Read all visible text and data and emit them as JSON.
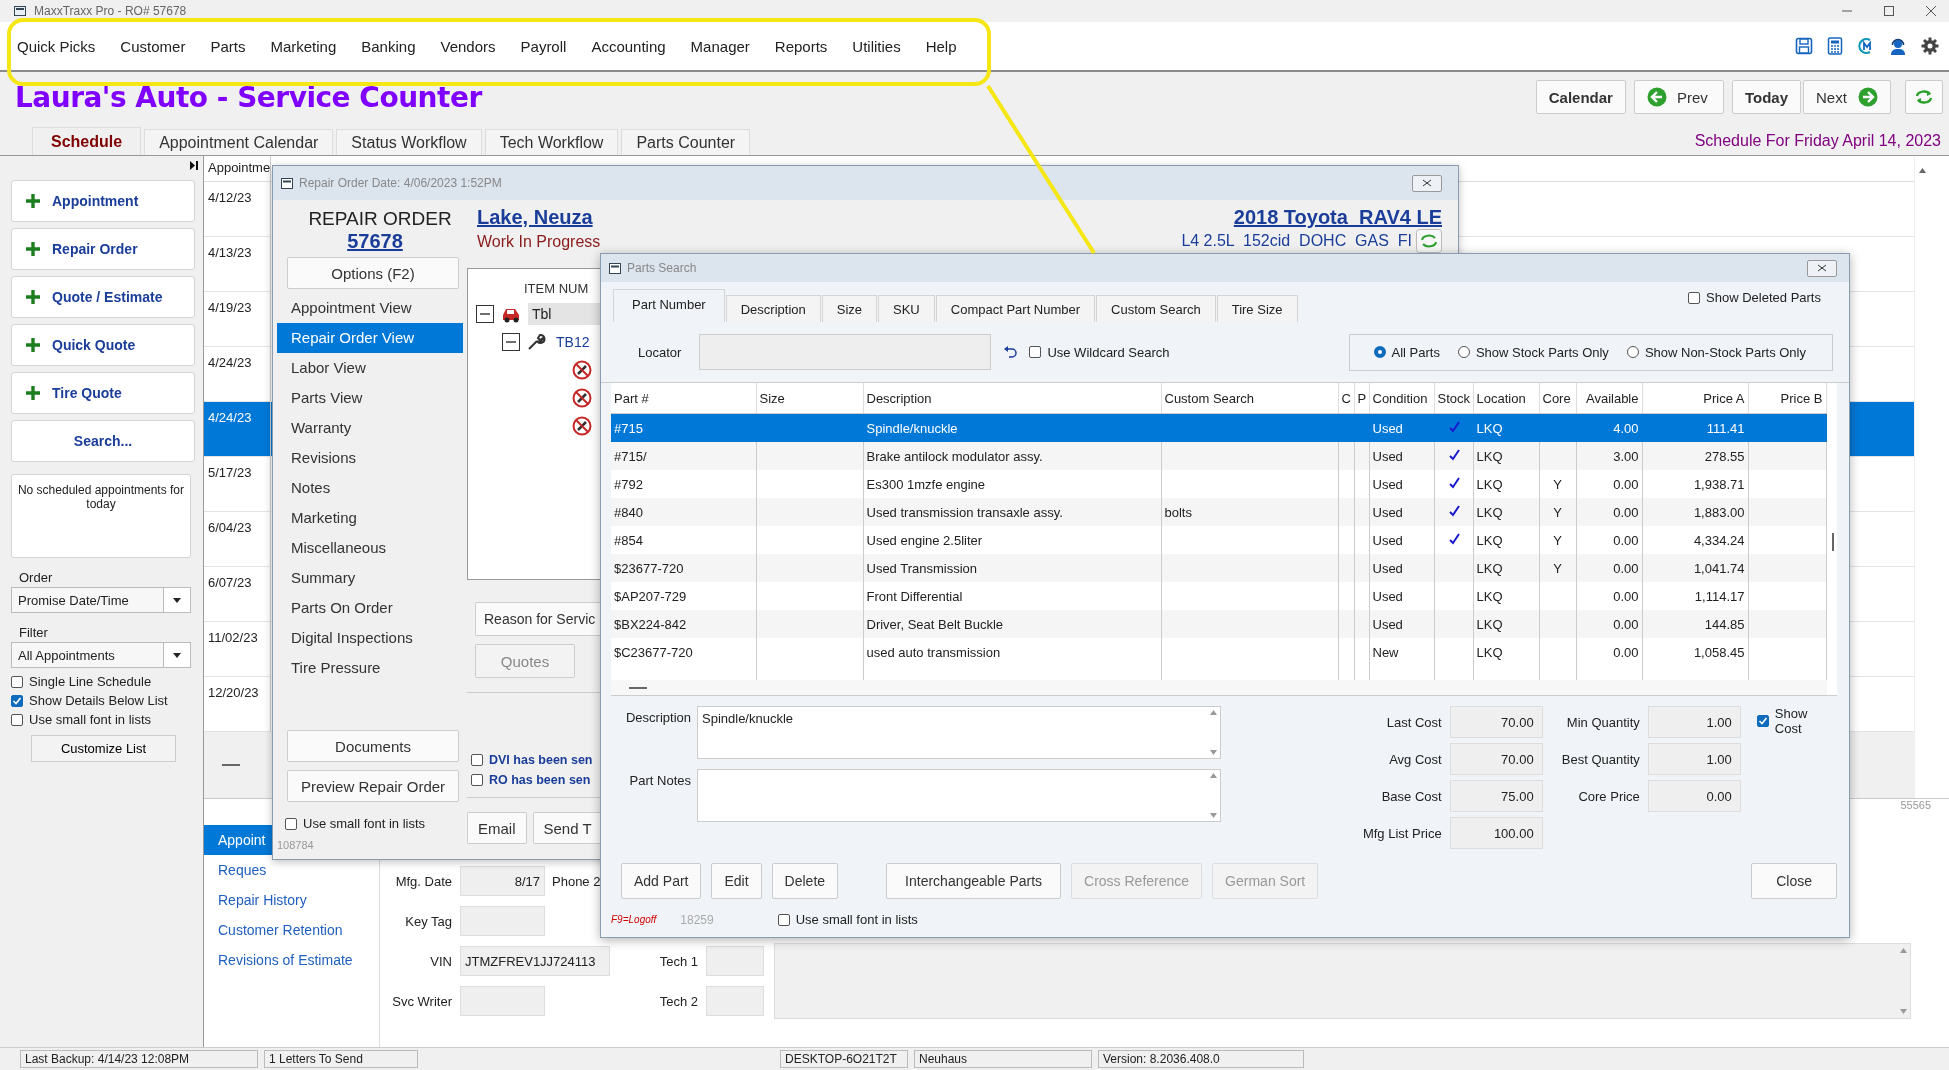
{
  "window": {
    "title": "MaxxTraxx Pro - RO# 57678"
  },
  "menu": [
    "Quick Picks",
    "Customer",
    "Parts",
    "Marketing",
    "Banking",
    "Vendors",
    "Payroll",
    "Accounting",
    "Manager",
    "Reports",
    "Utilities",
    "Help"
  ],
  "shop_title": "Laura's Auto - Service Counter",
  "nav_buttons": [
    {
      "label": "Calendar",
      "kind": "bold"
    },
    {
      "label": "Prev",
      "kind": "prev"
    },
    {
      "label": "Today",
      "kind": "bold"
    },
    {
      "label": "Next",
      "kind": "next"
    }
  ],
  "schedule_heading": "Schedule For Friday April 14, 2023",
  "tabs": [
    {
      "label": "Schedule",
      "selected": true
    },
    {
      "label": "Appointment Calendar",
      "selected": false
    },
    {
      "label": "Status Workflow",
      "selected": false
    },
    {
      "label": "Tech Workflow",
      "selected": false
    },
    {
      "label": "Parts Counter",
      "selected": false
    }
  ],
  "sidebar": {
    "actions": [
      {
        "label": "Appointment",
        "kind": "add"
      },
      {
        "label": "Repair Order",
        "kind": "add"
      },
      {
        "label": "Quote / Estimate",
        "kind": "add"
      },
      {
        "label": "Quick Quote",
        "kind": "add"
      },
      {
        "label": "Tire Quote",
        "kind": "add"
      },
      {
        "label": "Search...",
        "kind": "plain"
      }
    ],
    "empty_note": "No scheduled appointments for today",
    "order": {
      "label": "Order",
      "value": "Promise Date/Time"
    },
    "filter": {
      "label": "Filter",
      "value": "All Appointments"
    },
    "options": [
      {
        "label": "Single Line Schedule",
        "checked": false
      },
      {
        "label": "Show Details Below List",
        "checked": true
      },
      {
        "label": "Use small font in lists",
        "checked": false
      }
    ],
    "customize_button": "Customize List"
  },
  "appointments": {
    "header": "Appointme",
    "rows": [
      {
        "date": "4/12/23",
        "selected": false
      },
      {
        "date": "4/13/23",
        "selected": false
      },
      {
        "date": "4/19/23",
        "selected": false
      },
      {
        "date": "4/24/23",
        "selected": false
      },
      {
        "date": "4/24/23",
        "selected": true
      },
      {
        "date": "5/17/23",
        "selected": false
      },
      {
        "date": "6/04/23",
        "selected": false
      },
      {
        "date": "6/07/23",
        "selected": false
      },
      {
        "date": "11/02/23",
        "selected": false
      },
      {
        "date": "12/20/23",
        "selected": false
      }
    ]
  },
  "record_count": "55565",
  "bottom_links": [
    {
      "label": "Appoint",
      "selected": true
    },
    {
      "label": "Reques",
      "selected": false
    },
    {
      "label": "Repair History",
      "selected": false
    },
    {
      "label": "Customer Retention",
      "selected": false
    },
    {
      "label": "Revisions of Estimate",
      "selected": false
    }
  ],
  "vehicle_fields": [
    {
      "label": "Mfg. Date",
      "value": "8/17"
    },
    {
      "label": "Key Tag"
    },
    {
      "label": "VIN",
      "value": "JTMZFREV1JJ724113"
    },
    {
      "label": "Svc Writer"
    }
  ],
  "staff_fields": [
    {
      "label": "Phone 2",
      "kind": "label"
    },
    {
      "label": "Tech 1",
      "kind": "field"
    },
    {
      "label": "Tech 2",
      "kind": "field"
    }
  ],
  "status_bar": [
    "Last Backup:  4/14/23  12:08PM",
    "1 Letters To Send",
    "DESKTOP-6O21T2T",
    "Neuhaus",
    "Version:  8.2036.408.0"
  ],
  "repair_order": {
    "title": "Repair Order Date:  4/06/2023   1:52PM",
    "heading": "REPAIR ORDER",
    "number": "57678",
    "customer": "Lake, Neuza",
    "status": "Work In Progress",
    "vehicle": "2018 Toyota  RAV4 LE",
    "engine": "L4 2.5L  152cid  DOHC  GAS  FI",
    "options_button": "Options (F2)",
    "views": [
      {
        "label": "Appointment View",
        "selected": false
      },
      {
        "label": "Repair Order View",
        "selected": true
      },
      {
        "label": "Labor View",
        "selected": false
      },
      {
        "label": "Parts View",
        "selected": false
      },
      {
        "label": "Warranty",
        "selected": false
      },
      {
        "label": "Revisions",
        "selected": false
      },
      {
        "label": "Notes",
        "selected": false
      },
      {
        "label": "Marketing",
        "selected": false
      },
      {
        "label": "Miscellaneous",
        "selected": false
      },
      {
        "label": "Summary",
        "selected": false
      },
      {
        "label": "Parts On Order",
        "selected": false
      },
      {
        "label": "Digital Inspections",
        "selected": false
      },
      {
        "label": "Tire Pressure",
        "selected": false
      }
    ],
    "documents_button": "Documents",
    "preview_button": "Preview Repair Order",
    "small_font": {
      "label": "Use small font in lists",
      "checked": false
    },
    "code": "108784",
    "tree": {
      "header": "ITEM NUM",
      "items": [
        {
          "label": "Tbl",
          "kind": "vehicle",
          "expanded": true,
          "children": [
            {
              "label": "TB12",
              "kind": "job",
              "expanded": true,
              "children": [
                {
                  "kind": "part"
                },
                {
                  "kind": "part"
                },
                {
                  "kind": "part"
                }
              ]
            }
          ]
        }
      ]
    },
    "reason_button": "Reason for Servic",
    "quotes_button": "Quotes",
    "notices": [
      {
        "label": "DVI has been sen",
        "checked": false
      },
      {
        "label": "RO has been sen",
        "checked": false
      }
    ],
    "actions": [
      "Email",
      "Send T"
    ]
  },
  "parts_search": {
    "title": "Parts Search",
    "tabs": [
      {
        "label": "Part Number",
        "selected": true
      },
      {
        "label": "Description",
        "selected": false
      },
      {
        "label": "Size",
        "selected": false
      },
      {
        "label": "SKU",
        "selected": false
      },
      {
        "label": "Compact Part Number",
        "selected": false
      },
      {
        "label": "Custom Search",
        "selected": false
      },
      {
        "label": "Tire Size",
        "selected": false
      }
    ],
    "show_deleted": {
      "label": "Show Deleted Parts",
      "checked": false
    },
    "locator_label": "Locator",
    "wildcard": {
      "label": "Use Wildcard Search",
      "checked": false
    },
    "filters": [
      {
        "label": "All Parts",
        "selected": true
      },
      {
        "label": "Show Stock Parts Only",
        "selected": false
      },
      {
        "label": "Show Non-Stock Parts Only",
        "selected": false
      }
    ],
    "table": {
      "columns": [
        "Part #",
        "Size",
        "Description",
        "Custom Search",
        "C",
        "P",
        "Condition",
        "Stock",
        "Location",
        "Core",
        "Available",
        "Price A",
        "Price B"
      ],
      "rows": [
        {
          "part": "#715",
          "description": "Spindle/knuckle",
          "condition": "Used",
          "stock": true,
          "location": "LKQ",
          "available": "4.00",
          "price_a": "111.41",
          "selected": true
        },
        {
          "part": "#715/",
          "description": "Brake antilock modulator assy.",
          "condition": "Used",
          "stock": true,
          "location": "LKQ",
          "available": "3.00",
          "price_a": "278.55",
          "selected": false
        },
        {
          "part": "#792",
          "description": "Es300 1mzfe engine",
          "condition": "Used",
          "stock": true,
          "location": "LKQ",
          "core": "Y",
          "available": "0.00",
          "price_a": "1,938.71",
          "selected": false
        },
        {
          "part": "#840",
          "description": "Used transmission transaxle assy.",
          "custom": "bolts",
          "condition": "Used",
          "stock": true,
          "location": "LKQ",
          "core": "Y",
          "available": "0.00",
          "price_a": "1,883.00",
          "selected": false
        },
        {
          "part": "#854",
          "description": "Used engine 2.5liter",
          "condition": "Used",
          "stock": true,
          "location": "LKQ",
          "core": "Y",
          "available": "0.00",
          "price_a": "4,334.24",
          "selected": false
        },
        {
          "part": "$23677-720",
          "description": "Used Transmission",
          "condition": "Used",
          "stock": false,
          "location": "LKQ",
          "core": "Y",
          "available": "0.00",
          "price_a": "1,041.74",
          "selected": false
        },
        {
          "part": "$AP207-729",
          "description": "Front Differential",
          "condition": "Used",
          "stock": false,
          "location": "LKQ",
          "available": "0.00",
          "price_a": "1,114.17",
          "selected": false
        },
        {
          "part": "$BX224-842",
          "description": "Driver, Seat Belt Buckle",
          "condition": "Used",
          "stock": false,
          "location": "LKQ",
          "available": "0.00",
          "price_a": "144.85",
          "selected": false
        },
        {
          "part": "$C23677-720",
          "description": "used auto transmission",
          "condition": "New",
          "stock": false,
          "location": "LKQ",
          "available": "0.00",
          "price_a": "1,058.45",
          "selected": false
        }
      ]
    },
    "description_label": "Description",
    "description": "Spindle/knuckle",
    "notes_label": "Part Notes",
    "costs": [
      {
        "label": "Last Cost",
        "value": "70.00"
      },
      {
        "label": "Avg Cost",
        "value": "70.00"
      },
      {
        "label": "Base Cost",
        "value": "75.00"
      },
      {
        "label": "Mfg List Price",
        "value": "100.00"
      }
    ],
    "quantities": [
      {
        "label": "Min Quantity",
        "value": "1.00"
      },
      {
        "label": "Best Quantity",
        "value": "1.00"
      },
      {
        "label": "Core Price",
        "value": "0.00"
      }
    ],
    "show_cost": {
      "label": "Show Cost",
      "checked": true
    },
    "buttons": [
      {
        "label": "Add Part",
        "disabled": false
      },
      {
        "label": "Edit",
        "disabled": false
      },
      {
        "label": "Delete",
        "disabled": false
      },
      {
        "label": "Interchangeable Parts",
        "disabled": false
      },
      {
        "label": "Cross Reference",
        "disabled": true
      },
      {
        "label": "German Sort",
        "disabled": true
      },
      {
        "label": "Close",
        "disabled": false
      }
    ],
    "logoff": "F9=Logoff",
    "code": "18259",
    "small_font": {
      "label": "Use small font in lists",
      "checked": false
    }
  }
}
